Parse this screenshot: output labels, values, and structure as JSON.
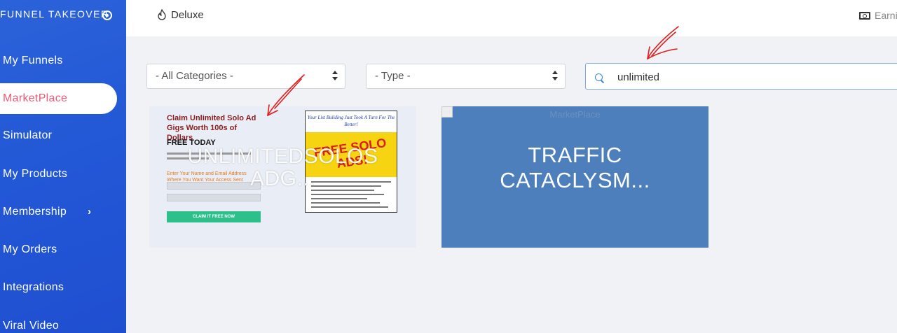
{
  "sidebar": {
    "brand": "FUNNEL TAKEOVER",
    "items": [
      {
        "label": "My Funnels"
      },
      {
        "label": "MarketPlace"
      },
      {
        "label": "Simulator"
      },
      {
        "label": "My Products"
      },
      {
        "label": "Membership",
        "chevron": "›"
      },
      {
        "label": "My Orders"
      },
      {
        "label": "Integrations"
      },
      {
        "label": "Viral Video"
      }
    ],
    "active_index": 1,
    "colors": {
      "background": "#2257d6",
      "active_text": "#ef5a74"
    }
  },
  "header": {
    "plan_label": "Deluxe",
    "earnings_label": "Earni"
  },
  "filters": {
    "category_value": "- All Categories -",
    "type_value": "- Type -",
    "search_value": "unlimited"
  },
  "cards": [
    {
      "title": "UNLIMITEDSOLOS ADG...",
      "thumbnail": {
        "headline": "Claim Unlimited Solo Ad Gigs Worth 100s of Dollars",
        "free_today": "FREE TODAY",
        "orange_text": "Enter Your Name and Email Address Where You Want Your Access Sent",
        "button_label": "CLAIM IT FREE NOW",
        "right_top": "Your List Building Just Took A Turn For The Better!",
        "right_big": "FREE SOLO ADS!"
      }
    },
    {
      "title": "TRAFFIC CATACLYSM...",
      "image_alt": "MarketPlace",
      "background": "#4d7fbd"
    }
  ]
}
